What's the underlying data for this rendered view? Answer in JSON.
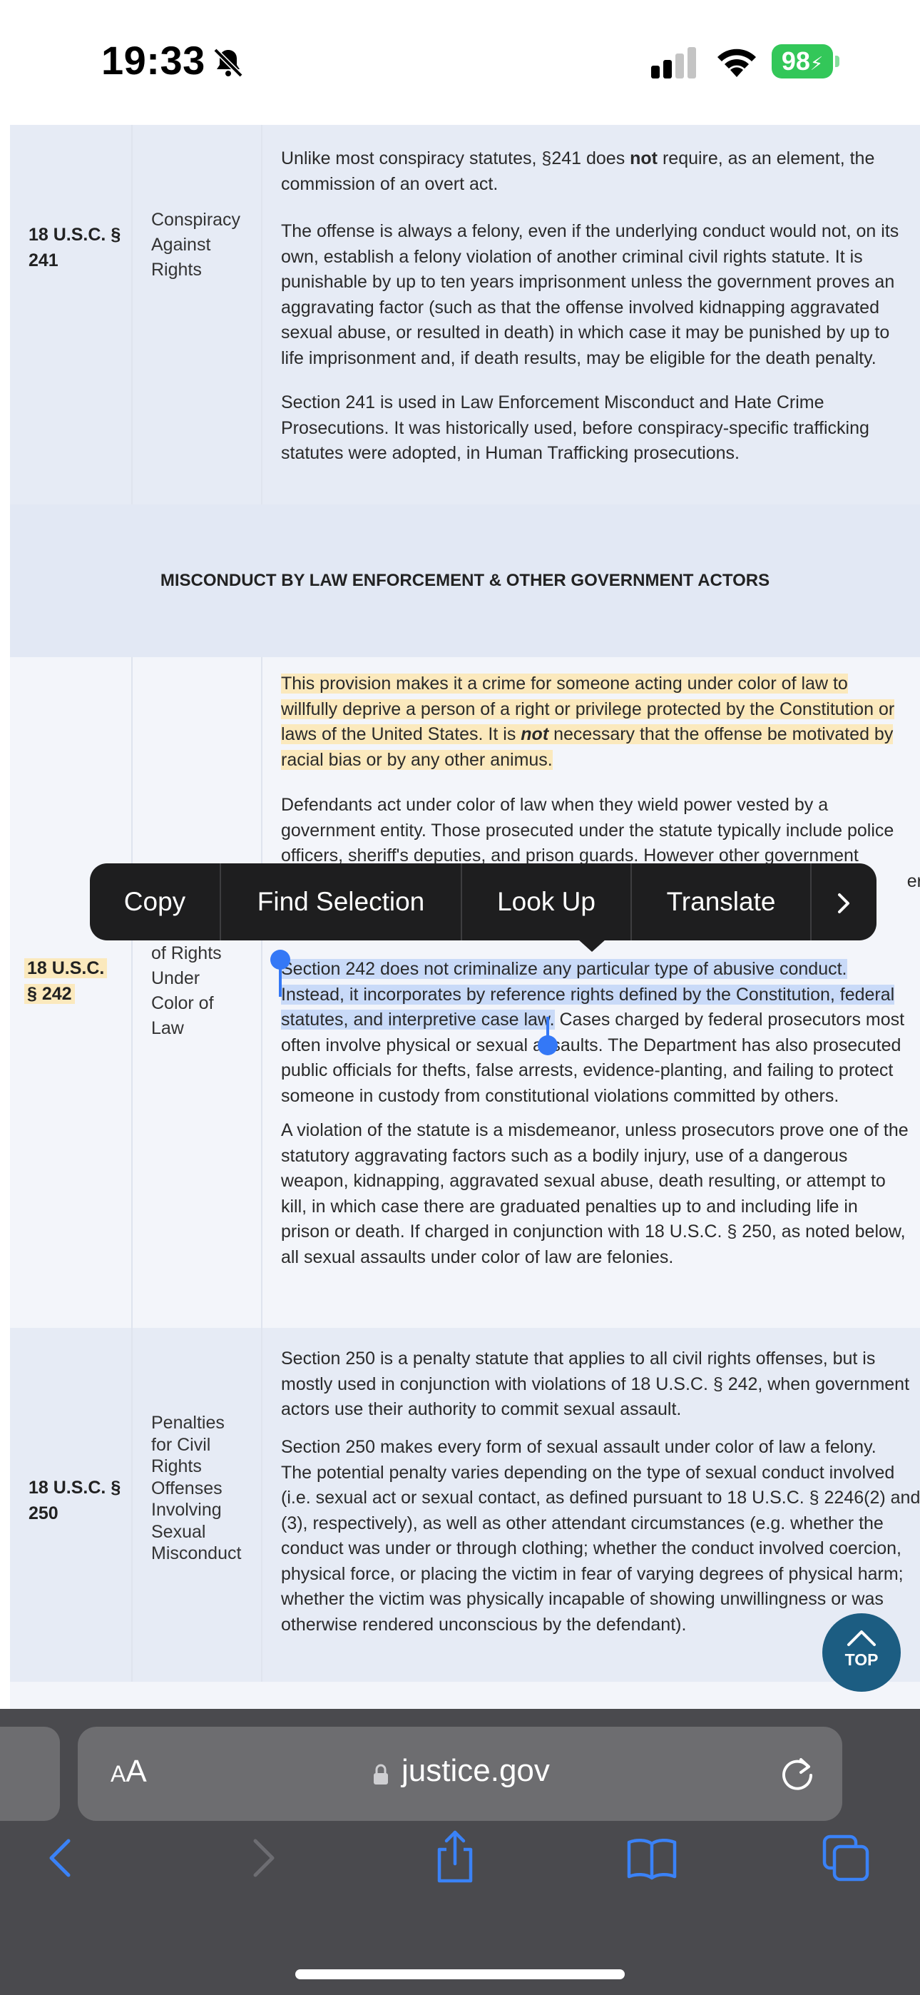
{
  "status_bar": {
    "time": "19:33",
    "battery": "98",
    "icons": [
      "bell-slash-icon",
      "cellular-signal-icon",
      "wifi-icon",
      "battery-charging-icon"
    ]
  },
  "rows": [
    {
      "citation": "18 U.S.C. § 241",
      "citation_lines": [
        "18 U.S.C. §",
        "241"
      ],
      "topic_lines": [
        "Conspiracy",
        "Against",
        "Rights"
      ],
      "paragraphs": [
        [
          "Unlike most conspiracy statutes, §241 does ",
          "not",
          " require, as an element, the",
          "commission of an overt act."
        ],
        [
          "The offense is always a felony, even if the underlying conduct would not, on its",
          "own, establish a felony violation of another criminal civil rights statute.  It is",
          "punishable by up to ten years imprisonment unless the government proves an",
          "aggravating factor (such as that the offense involved kidnapping aggravated",
          "sexual abuse, or resulted in death) in which case it may be punished by up to",
          "life imprisonment and, if death results, may be eligible for the death penalty."
        ],
        [
          "Section 241 is used in Law Enforcement Misconduct and Hate Crime",
          "Prosecutions. It was historically used, before conspiracy-specific trafficking",
          "statutes were adopted, in Human Trafficking prosecutions."
        ]
      ]
    },
    {
      "section_heading": "MISCONDUCT BY LAW ENFORCEMENT & OTHER GOVERNMENT ACTORS"
    },
    {
      "citation_lines": [
        "18 U.S.C.",
        "§ 242"
      ],
      "topic_lines": [
        "of Rights",
        "Under",
        "Color of",
        "Law"
      ],
      "highlight_lines": [
        "This provision makes it a crime for someone acting under color of law to",
        "willfully deprive a person of a right or privilege protected by the Constitution or",
        "laws of the United States. It is ",
        "not",
        " necessary that the offense be motivated by",
        "racial bias or by any other animus."
      ],
      "p2_lines": [
        "Defendants act under color of law when they wield power vested by a",
        "government entity.  Those prosecuted under the statute typically include police",
        "officers, sheriff's deputies, and prison guards. However other government",
        "er"
      ],
      "selected_lines": [
        "Section 242 does not criminalize any particular type of abusive conduct.",
        "Instead, it incorporates by reference rights defined by the Constitution, federal",
        "statutes, and interpretive case law."
      ],
      "p3_rest_lines": [
        " Cases charged by federal prosecutors most",
        "often involve physical or sexual assaults.  The Department has also prosecuted",
        "public officials for thefts, false arrests, evidence-planting, and failing to protect",
        "someone in custody from constitutional violations committed by others."
      ],
      "p4_lines": [
        "A violation of the statute is a misdemeanor, unless prosecutors prove one of the",
        "statutory aggravating factors such as a bodily injury, use of a dangerous",
        "weapon, kidnapping, aggravated sexual abuse, death resulting, or attempt to",
        "kill, in which case there are graduated penalties up to and including life in",
        "prison or death. If charged in conjunction with 18 U.S.C. § 250, as noted below,",
        "all sexual assaults under color of law are felonies."
      ]
    },
    {
      "citation_lines": [
        "18 U.S.C. §",
        "250"
      ],
      "topic_lines": [
        "Penalties",
        "for Civil",
        "Rights",
        "Offenses",
        "Involving",
        "Sexual",
        "Misconduct"
      ],
      "p1_lines": [
        "Section 250 is a penalty statute that applies to all civil rights offenses, but is",
        "mostly used in conjunction with violations of 18 U.S.C. § 242, when government",
        "actors use their authority to commit sexual assault."
      ],
      "p2_lines": [
        "Section 250 makes every form of sexual assault under color of law a felony.",
        "The potential penalty varies depending on the type of sexual conduct involved",
        "(i.e. sexual act or sexual contact, as defined pursuant to 18 U.S.C. § 2246(2) and",
        "(3), respectively), as well as other attendant circumstances (e.g. whether the",
        "conduct was under or through clothing; whether the conduct involved coercion,",
        "physical force, or placing the victim in fear of varying degrees of physical harm;",
        "whether the victim was physically incapable of showing unwillingness or was",
        "otherwise rendered unconscious by the defendant)."
      ]
    }
  ],
  "context_menu": {
    "items": [
      "Copy",
      "Find Selection",
      "Look Up",
      "Translate"
    ],
    "more_icon": "chevron-right-icon"
  },
  "top_button": {
    "label": "TOP",
    "icon": "chevron-up-icon"
  },
  "browser": {
    "text_size_label_small": "A",
    "text_size_label_large": "A",
    "url": "justice.gov",
    "icons": [
      "lock-icon",
      "reload-icon",
      "back-icon",
      "forward-icon",
      "share-icon",
      "bookmarks-icon",
      "tabs-icon"
    ]
  }
}
